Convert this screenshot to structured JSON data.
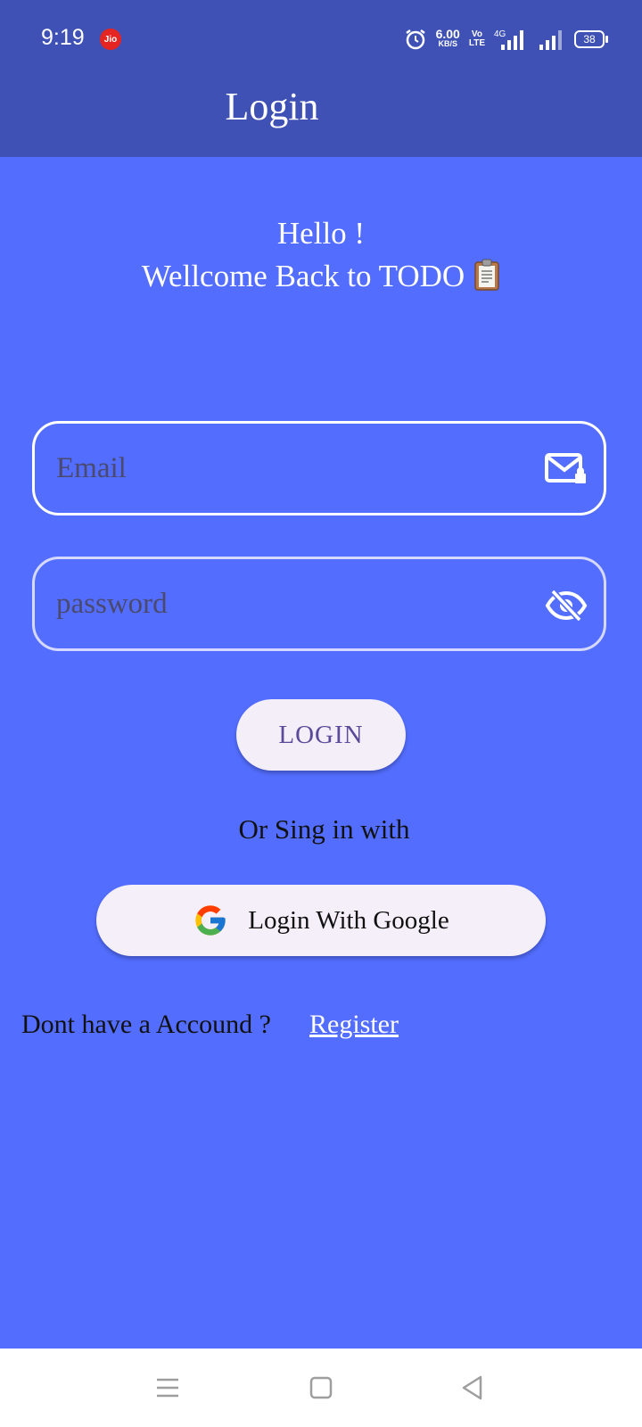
{
  "status_bar": {
    "time": "9:19",
    "carrier_badge": "Jio",
    "net_speed_value": "6.00",
    "net_speed_unit": "KB/S",
    "volte_top": "Vo",
    "volte_bottom": "LTE",
    "network_type": "4G",
    "battery": "38"
  },
  "app_bar": {
    "title": "Login"
  },
  "greeting": {
    "line1": "Hello !",
    "line2": "Wellcome Back  to TODO"
  },
  "form": {
    "email_placeholder": "Email",
    "password_placeholder": "password",
    "login_label": "LOGIN"
  },
  "alt_login": {
    "separator": "Or Sing in with",
    "google_label": "Login With Google"
  },
  "register": {
    "prompt": "Dont have a Accound ?",
    "link": "Register"
  },
  "colors": {
    "background": "#536dfe",
    "app_bar": "#3f51b5",
    "button_bg": "#f3eef8"
  },
  "icons": [
    "alarm-icon",
    "signal-icon",
    "clipboard-icon",
    "mail-lock-icon",
    "eye-off-icon",
    "google-logo-icon",
    "menu-icon",
    "home-icon",
    "back-icon"
  ]
}
